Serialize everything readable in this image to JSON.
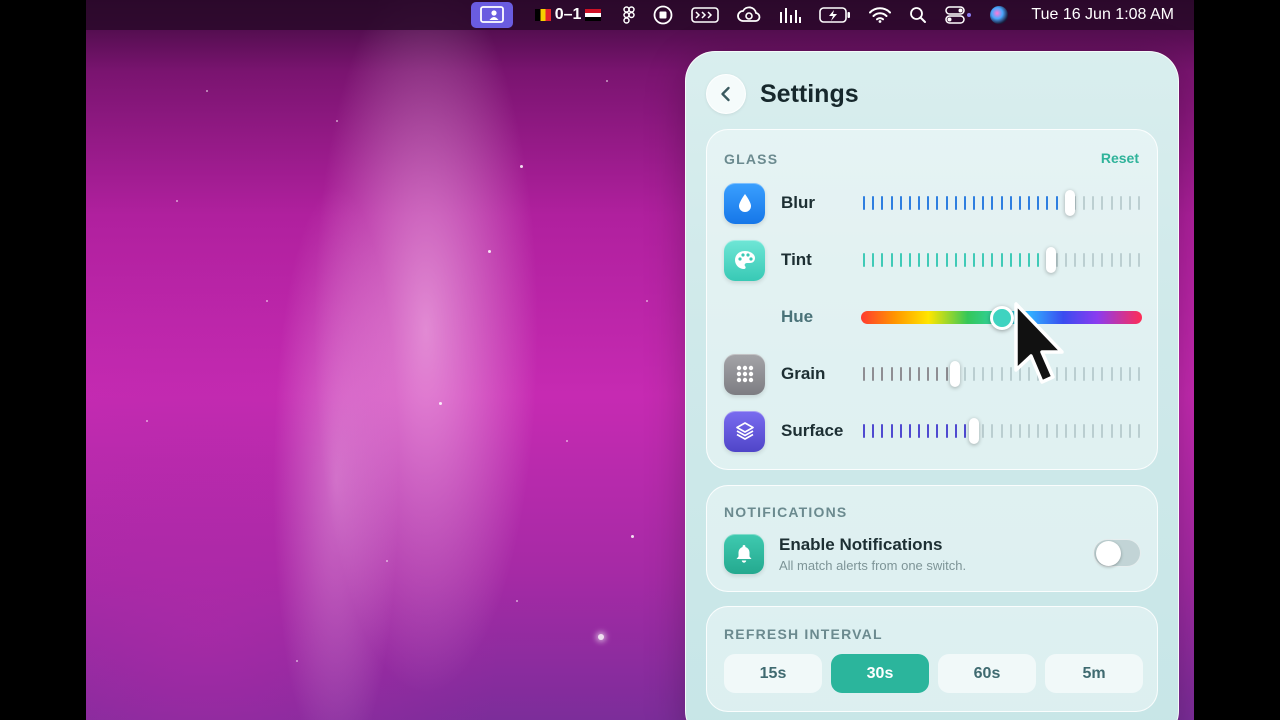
{
  "menubar": {
    "score": "0–1",
    "clock": "Tue 16 Jun  1:08 AM",
    "icons": [
      "screen-share-icon",
      "belgium-flag",
      "egypt-flag",
      "figma-icon",
      "record-icon",
      "mask-icon",
      "creative-cloud-icon",
      "equalizer-icon",
      "battery-icon",
      "wifi-icon",
      "search-icon",
      "control-center-icon",
      "siri-icon"
    ]
  },
  "panel": {
    "title": "Settings",
    "back_icon": "chevron-left-icon"
  },
  "glass": {
    "section_label": "GLASS",
    "reset_label": "Reset",
    "blur": {
      "label": "Blur",
      "icon": "drop-icon",
      "color": "#1e8cf5",
      "value": 0.75
    },
    "tint": {
      "label": "Tint",
      "icon": "palette-icon",
      "color": "#4fd8c5",
      "value": 0.68
    },
    "hue": {
      "label": "Hue",
      "value": 0.5
    },
    "grain": {
      "label": "Grain",
      "icon": "grid-dots-icon",
      "color": "#8e8e93",
      "value": 0.33
    },
    "surface": {
      "label": "Surface",
      "icon": "layers-icon",
      "color": "#5b57d6",
      "value": 0.4
    }
  },
  "notifications": {
    "section_label": "NOTIFICATIONS",
    "title": "Enable Notifications",
    "subtitle": "All match alerts from one switch.",
    "icon": "bell-icon",
    "enabled": false
  },
  "refresh": {
    "section_label": "REFRESH INTERVAL",
    "options": [
      "15s",
      "30s",
      "60s",
      "5m"
    ],
    "selected": "30s"
  },
  "colors": {
    "accent": "#2bb59c",
    "menubar_active": "#6a5ce0"
  }
}
